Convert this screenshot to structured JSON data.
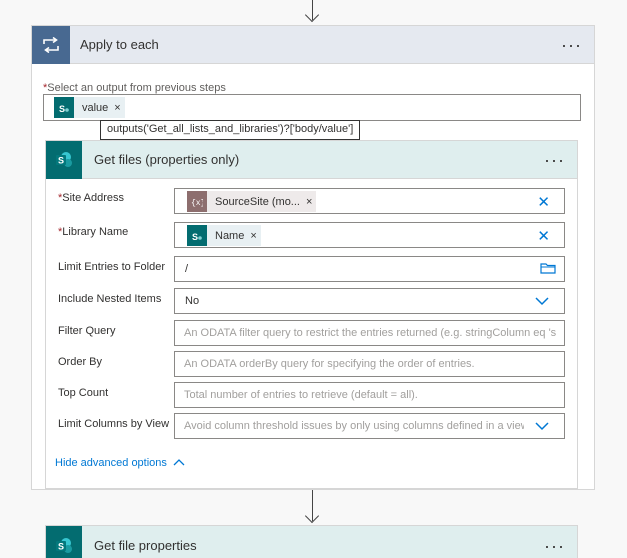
{
  "apply_to_each": {
    "title": "Apply to each",
    "more_label": "···",
    "select_label": "Select an output from previous steps",
    "required_star": "*",
    "value_token": "value",
    "token_close": "×",
    "tooltip": "outputs('Get_all_lists_and_libraries')?['body/value']"
  },
  "get_files": {
    "title": "Get files (properties only)",
    "more_label": "···",
    "fields": {
      "site_address": {
        "label": "Site Address",
        "token": "SourceSite (mo...",
        "clear": "✕"
      },
      "library_name": {
        "label": "Library Name",
        "token": "Name",
        "clear": "✕"
      },
      "limit_folder": {
        "label": "Limit Entries to Folder",
        "value": "/"
      },
      "nested": {
        "label": "Include Nested Items",
        "value": "No"
      },
      "filter_query": {
        "label": "Filter Query",
        "placeholder": "An ODATA filter query to restrict the entries returned (e.g. stringColumn eq 'strin"
      },
      "order_by": {
        "label": "Order By",
        "placeholder": "An ODATA orderBy query for specifying the order of entries."
      },
      "top_count": {
        "label": "Top Count",
        "placeholder": "Total number of entries to retrieve (default = all)."
      },
      "limit_view": {
        "label": "Limit Columns by View",
        "placeholder": "Avoid column threshold issues by only using columns defined in a view"
      }
    },
    "advanced_link": "Hide advanced options"
  },
  "get_file_properties": {
    "title": "Get file properties",
    "more_label": "···"
  },
  "colors": {
    "loop_accent": "#486991",
    "sharepoint": "#036c70",
    "link": "#0078d4"
  }
}
